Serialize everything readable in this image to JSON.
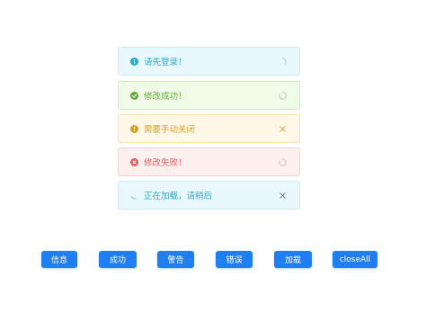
{
  "messages": [
    {
      "type": "info",
      "text": "请先登录！",
      "trail": "spinner"
    },
    {
      "type": "success",
      "text": "修改成功！",
      "trail": "spinner"
    },
    {
      "type": "warning",
      "text": "需要手动关闭",
      "trail": "close"
    },
    {
      "type": "error",
      "text": "修改失败！",
      "trail": "spinner"
    },
    {
      "type": "loading",
      "text": "正在加载，请稍后",
      "trail": "close"
    }
  ],
  "buttons": {
    "info": "信息",
    "success": "成功",
    "warning": "警告",
    "error": "错误",
    "loading": "加载",
    "close_all": "closeAll"
  },
  "colors": {
    "info": "#2ba9c6",
    "success": "#6aa73b",
    "warning": "#d7a12a",
    "error": "#e55a5a",
    "button": "#1f7ef0"
  },
  "icons": {
    "info": "info-icon",
    "success": "check-circle-icon",
    "warning": "exclamation-circle-icon",
    "error": "x-circle-icon",
    "loading": "loading-spinner-icon",
    "dismiss": "close-icon"
  }
}
